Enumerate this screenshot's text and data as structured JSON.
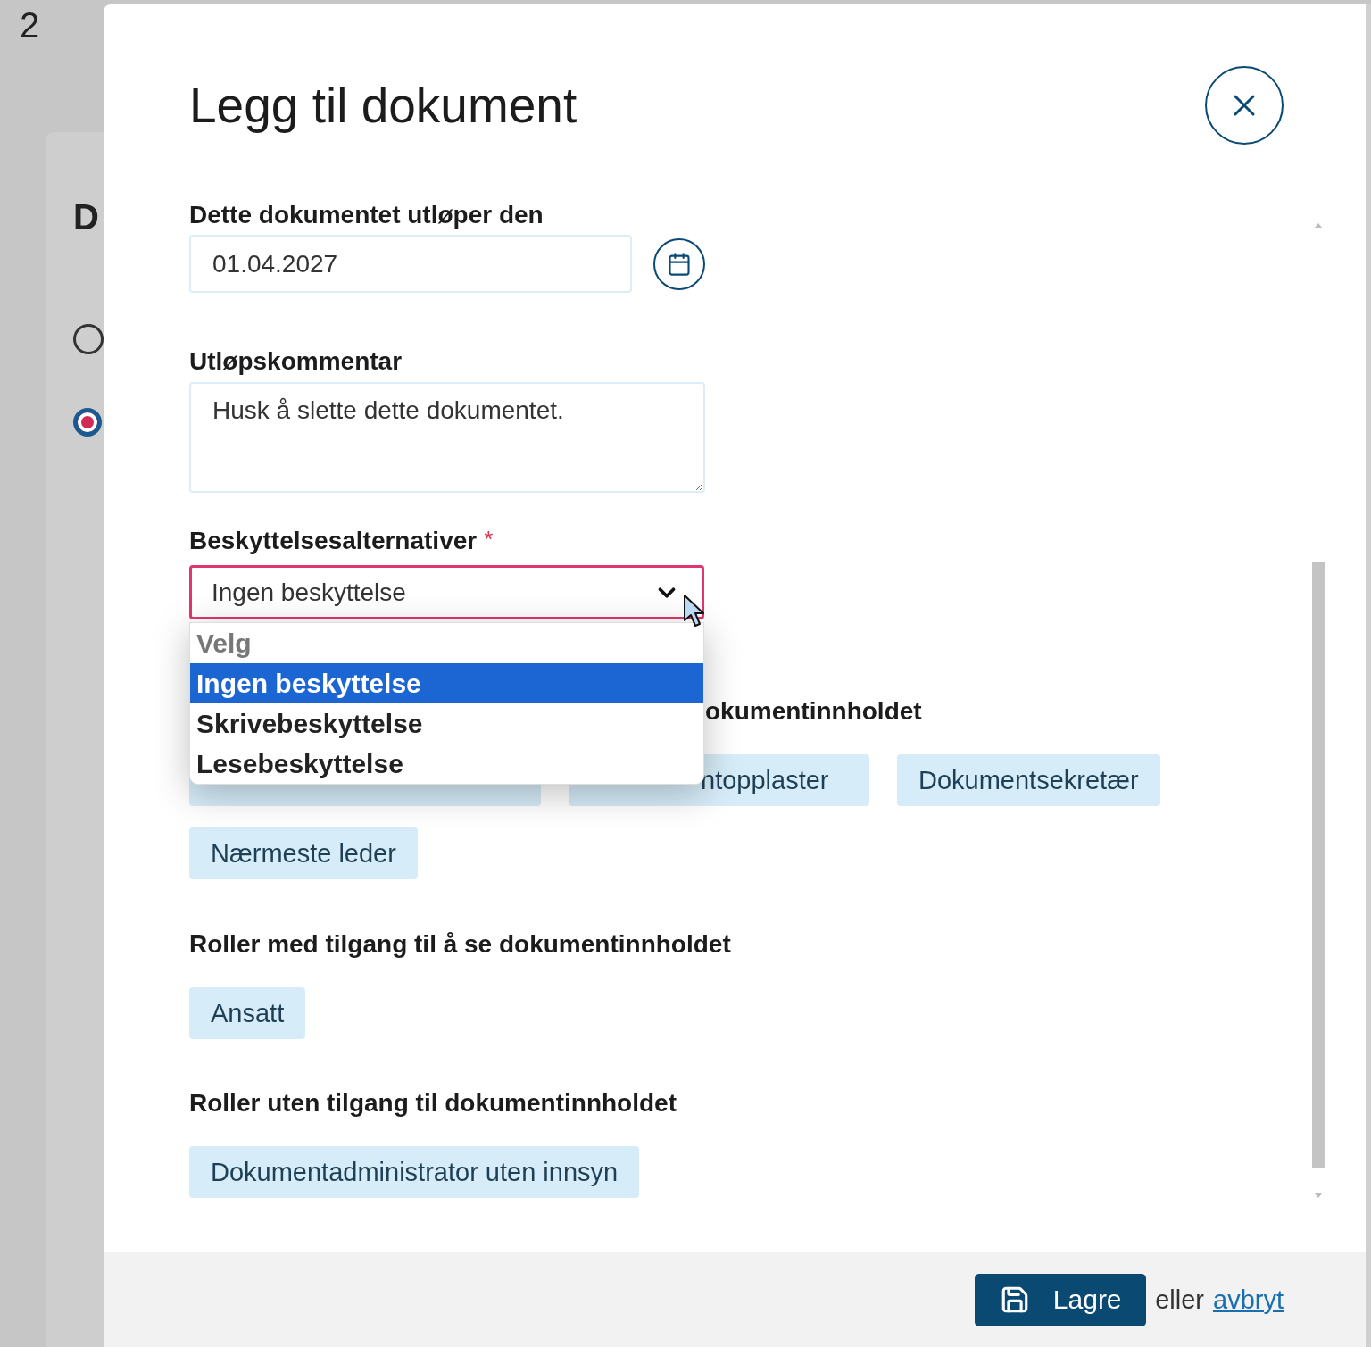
{
  "background": {
    "heading": "2",
    "letter": "D",
    "radio": {
      "selected": true
    }
  },
  "modal": {
    "title": "Legg til dokument"
  },
  "expiry_date": {
    "label": "Dette dokumentet utløper den",
    "value": "01.04.2027"
  },
  "expiry_comment": {
    "label": "Utløpskommentar",
    "value": "Husk å slette dette dokumentet."
  },
  "protection": {
    "label": "Beskyttelsesalternativer",
    "required_mark": "*",
    "value": "Ingen beskyttelse",
    "expanded": true,
    "options": [
      {
        "label": "Velg",
        "disabled": true,
        "selected": false
      },
      {
        "label": "Ingen beskyttelse",
        "disabled": false,
        "selected": true
      },
      {
        "label": "Skrivebeskyttelse",
        "disabled": false,
        "selected": false
      },
      {
        "label": "Lesebeskyttelse",
        "disabled": false,
        "selected": false
      }
    ]
  },
  "role_groups": [
    {
      "title": "okumentinnholdet",
      "roles": [
        {
          "kind": "covered"
        },
        {
          "kind": "covered",
          "label": "ntopplaster"
        },
        {
          "kind": "tag",
          "label": "Dokumentsekretær"
        },
        {
          "kind": "tag",
          "label": "Nærmeste leder"
        }
      ]
    },
    {
      "title": "Roller med tilgang til å se dokumentinnholdet",
      "roles": [
        {
          "kind": "tag",
          "label": "Ansatt"
        }
      ]
    },
    {
      "title": "Roller uten tilgang til dokumentinnholdet",
      "roles": [
        {
          "kind": "tag",
          "label": "Dokumentadministrator uten innsyn"
        }
      ]
    }
  ],
  "footer": {
    "save": "Lagre",
    "or": "eller",
    "cancel": "avbryt"
  }
}
